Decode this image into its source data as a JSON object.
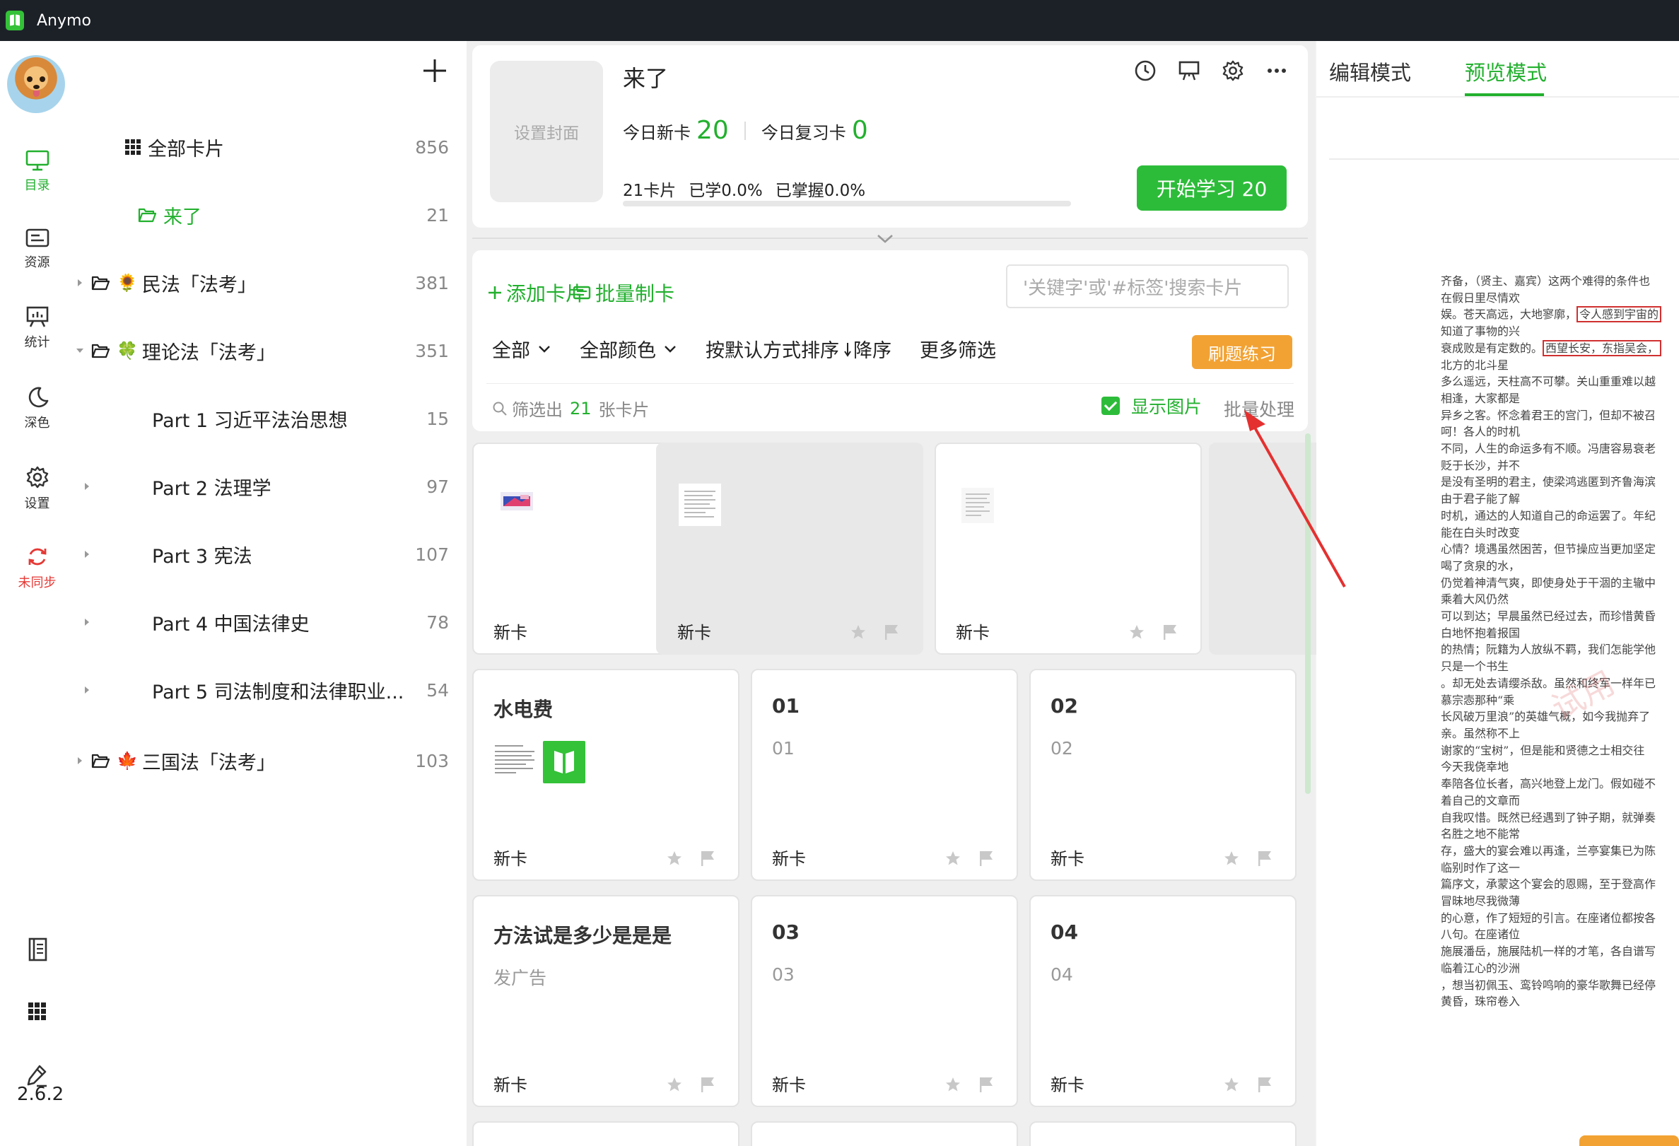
{
  "window": {
    "title": "Anymo",
    "version": "2.6.2"
  },
  "rail": {
    "items": [
      {
        "label": "目录",
        "icon": "monitor-icon",
        "active": true
      },
      {
        "label": "资源",
        "icon": "resource-card-icon"
      },
      {
        "label": "统计",
        "icon": "stats-board-icon"
      },
      {
        "label": "深色",
        "icon": "moon-icon"
      },
      {
        "label": "设置",
        "icon": "gear-icon"
      },
      {
        "label": "未同步",
        "icon": "sync-icon",
        "warn": true
      }
    ],
    "bottom_icons": [
      "notebook-icon",
      "grid-icon",
      "edit-pen-icon"
    ]
  },
  "tree": {
    "items": [
      {
        "label": "全部卡片",
        "count": "856",
        "icon": "grid-icon"
      },
      {
        "label": "来了",
        "count": "21",
        "icon": "folder-icon",
        "active": true
      },
      {
        "label": "民法「法考」",
        "count": "381",
        "emoji": "🌻"
      },
      {
        "label": "理论法「法考」",
        "count": "351",
        "emoji": "🍀"
      },
      {
        "label": "Part 1 习近平法治思想",
        "count": "15"
      },
      {
        "label": "Part 2 法理学",
        "count": "97"
      },
      {
        "label": "Part 3 宪法",
        "count": "107"
      },
      {
        "label": "Part 4 中国法律史",
        "count": "78"
      },
      {
        "label": "Part 5 司法制度和法律职业...",
        "count": "54"
      },
      {
        "label": "三国法「法考」",
        "count": "103",
        "emoji": "🍁"
      }
    ]
  },
  "deck": {
    "cover_label": "设置封面",
    "title": "来了",
    "new_label": "今日新卡",
    "new_count": "20",
    "review_label": "今日复习卡",
    "review_count": "0",
    "cards_total": "21卡片",
    "learned": "已学0.0%",
    "mastered": "已掌握0.0%",
    "progress": 0.0,
    "start_button": "开始学习 20"
  },
  "toolbar": {
    "add_card": "添加卡片",
    "batch_make": "批量制卡",
    "search_placeholder": "'关键字'或'#标签'搜索卡片",
    "filter_all": "全部",
    "filter_color": "全部颜色",
    "sort": "按默认方式排序",
    "sort_order": "降序",
    "more_filters": "更多筛选",
    "practice": "刷题练习",
    "result_prefix": "筛选出",
    "result_count": "21",
    "result_suffix": "张卡片",
    "show_images": "显示图片",
    "batch_process": "批量处理"
  },
  "cards": [
    {
      "title": "",
      "sub": "",
      "status": "新卡",
      "thumb": "image-thumb"
    },
    {
      "title": "",
      "sub": "",
      "status": "新卡",
      "thumb": "doc-thumb",
      "selected": true
    },
    {
      "title": "",
      "sub": "",
      "status": "新卡",
      "thumb": "doc-thumb-small"
    },
    {
      "title": "水电费",
      "sub": "",
      "status": "新卡",
      "thumb": "doc-and-logo"
    },
    {
      "title": "01",
      "sub": "01",
      "status": "新卡"
    },
    {
      "title": "02",
      "sub": "02",
      "status": "新卡"
    },
    {
      "title": "方法试是多少是是是",
      "sub": "发广告",
      "status": "新卡"
    },
    {
      "title": "03",
      "sub": "03",
      "status": "新卡"
    },
    {
      "title": "04",
      "sub": "04",
      "status": "新卡"
    }
  ],
  "preview": {
    "tab_edit": "编辑模式",
    "tab_preview": "预览模式",
    "doc_lines": [
      "齐备，（贤主、嘉宾）这两个难得的条件也",
      "在假日里尽情欢",
      "娱。苍天高远，大地寥廓，|令人感到宇宙的",
      "知道了事物的兴",
      "衰成败是有定数的。|西望长安，东指吴会，",
      "北方的北斗星",
      "多么遥远，天柱高不可攀。关山重重难以越",
      "相逢，大家都是",
      "异乡之客。怀念着君王的宫门，但却不被召",
      "呵！各人的时机",
      "不同，人生的命运多有不顺。冯唐容易衰老",
      "贬于长沙，并不",
      "是没有圣明的君主，使梁鸿逃匿到齐鲁海滨",
      "由于君子能了解",
      "时机，通达的人知道自己的命运罢了。年纪",
      "能在白头时改变",
      "心情？境遇虽然困苦，但节操应当更加坚定",
      "喝了贪泉的水，",
      "仍觉着神清气爽，即使身处于干涸的主辙中",
      "乘着大风仍然",
      "可以到达；早晨虽然已经过去，而珍惜黄昏",
      "白地怀抱着报国",
      "的热情；阮籍为人放纵不羁，我们怎能学他",
      "只是一个书生",
      "。却无处去请缨杀敌。虽然和终军一样年已",
      "慕宗悫那种“乘",
      "长风破万里浪”的英雄气概，如今我抛弃了",
      "亲。虽然称不上",
      "谢家的“宝树”，但是能和贤德之士相交往",
      "今天我侥幸地",
      "奉陪各位长者，高兴地登上龙门。假如碰不",
      "着自己的文章而",
      "自我叹惜。既然已经遇到了钟子期，就弹奏",
      "名胜之地不能常",
      "存，盛大的宴会难以再逢，兰亭宴集已为陈",
      "临别时作了这一",
      "篇序文，承蒙这个宴会的恩赐，至于登高作",
      "冒昧地尽我微薄",
      "的心意，作了短短的引言。在座诸位都按各",
      "八句。在座诸位",
      "施展潘岳，施展陆机一样的才笔，各自谱写",
      "临着江心的沙洲",
      "，想当初佩玉、鸾铃鸣响的豪华歌舞已经停",
      "黄昏，珠帘卷入"
    ],
    "watermark": "试用"
  },
  "colors": {
    "accent": "#22b02e",
    "button_green": "#2dbc3a",
    "orange": "#f2a233",
    "warn": "#e53935"
  }
}
